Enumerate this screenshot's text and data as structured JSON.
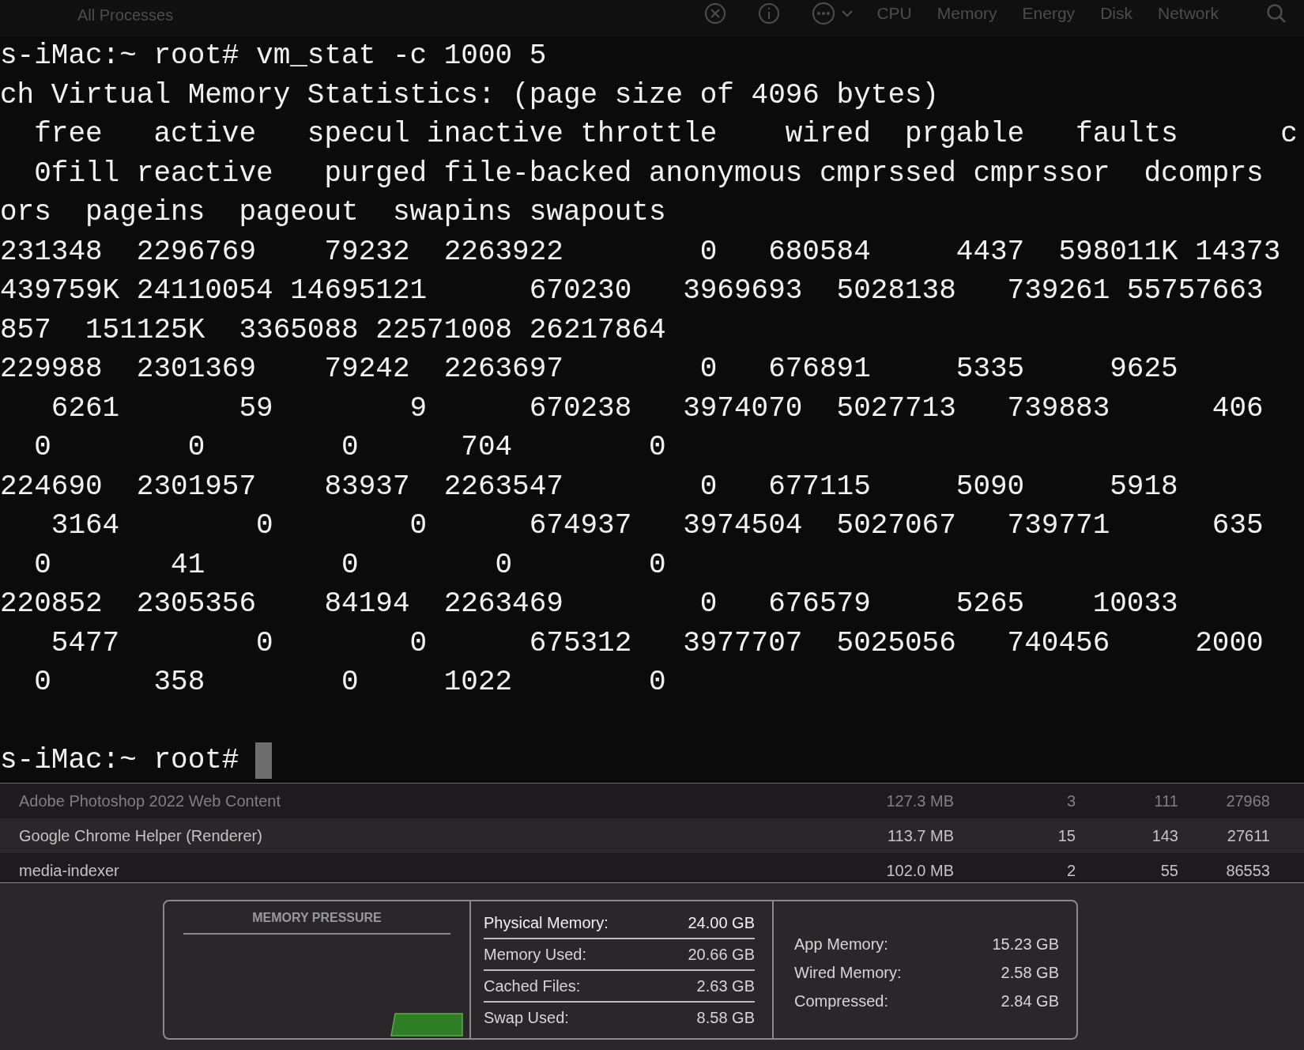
{
  "toolbar": {
    "view_title": "All Processes",
    "tabs": [
      "CPU",
      "Memory",
      "Energy",
      "Disk",
      "Network"
    ]
  },
  "terminal": {
    "lines": [
      "s-iMac:~ root# vm_stat -c 1000 5",
      "ch Virtual Memory Statistics: (page size of 4096 bytes)",
      "  free   active   specul inactive throttle    wired  prgable   faults      c",
      "  0fill reactive   purged file-backed anonymous cmprssed cmprssor  dcomprs",
      "ors  pageins  pageout  swapins swapouts",
      "231348  2296769    79232  2263922        0   680584     4437  598011K 14373",
      "439759K 24110054 14695121      670230   3969693  5028138   739261 55757663",
      "857  151125K  3365088 22571008 26217864",
      "229988  2301369    79242  2263697        0   676891     5335     9625",
      "   6261       59        9      670238   3974070  5027713   739883      406",
      "  0        0        0      704        0",
      "224690  2301957    83937  2263547        0   677115     5090     5918",
      "   3164        0        0      674937   3974504  5027067   739771      635",
      "  0       41        0        0        0",
      "220852  2305356    84194  2263469        0   676579     5265    10033",
      "   5477        0        0      675312   3977707  5025056   740456     2000",
      "  0      358        0     1022        0"
    ],
    "prompt": "s-iMac:~ root#"
  },
  "processes": [
    {
      "name": "Adobe Photoshop 2022 Web Content",
      "memory": "127.3 MB",
      "threads": "3",
      "ports": "111",
      "pid": "27968"
    },
    {
      "name": "Google Chrome Helper (Renderer)",
      "memory": "113.7 MB",
      "threads": "15",
      "ports": "143",
      "pid": "27611"
    },
    {
      "name": "media-indexer",
      "memory": "102.0 MB",
      "threads": "2",
      "ports": "55",
      "pid": "86553"
    }
  ],
  "memory_pressure": {
    "title": "MEMORY PRESSURE"
  },
  "memory_stats": [
    {
      "label": "Physical Memory:",
      "value": "24.00 GB"
    },
    {
      "label": "Memory Used:",
      "value": "20.66 GB"
    },
    {
      "label": "Cached Files:",
      "value": "2.63 GB"
    },
    {
      "label": "Swap Used:",
      "value": "8.58 GB"
    }
  ],
  "memory_breakdown": [
    {
      "label": "App Memory:",
      "value": "15.23 GB"
    },
    {
      "label": "Wired Memory:",
      "value": "2.58 GB"
    },
    {
      "label": "Compressed:",
      "value": "2.84 GB"
    }
  ]
}
